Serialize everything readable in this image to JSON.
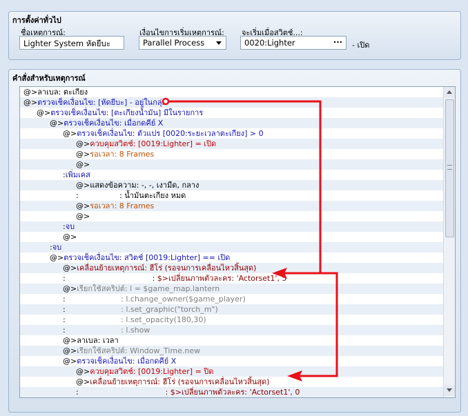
{
  "general": {
    "title": "การตั้งค่าทั่วไป",
    "event_name_label": "ชื่อเหตุการณ์:",
    "event_name_value": "Lighter System หัดยีบะ",
    "trigger_label": "เงื่อนไขการเริ่มเหตุการณ์:",
    "trigger_value": "Parallel Process",
    "switch_label": "จะเริ่มเมื่อสวิตช์...:",
    "switch_value": "0020:Lighter",
    "switch_suffix": "- เปิด"
  },
  "commands": {
    "title": "คำสั่งสำหรับเหตุการณ์",
    "rows": [
      {
        "indent": 0,
        "color": "#000000",
        "marker": "@>",
        "text": "ลาเบล: ตะเกียง"
      },
      {
        "indent": 0,
        "color": "#1515b0",
        "marker": "@>",
        "text": "ตรวจเช็คเงื่อนไข: [หัดยีบะ] - อยู่ในกลุ่ม"
      },
      {
        "indent": 1,
        "color": "#1515b0",
        "marker": "@>",
        "text": "ตรวจเช็คเงื่อนไข: [ตะเกียงน้ำมัน] มีในรายการ"
      },
      {
        "indent": 2,
        "color": "#1515b0",
        "marker": "@>",
        "text": "ตรวจเช็คเงื่อนไข: เมื่อกดคีย์ X"
      },
      {
        "indent": 3,
        "color": "#1515b0",
        "marker": "@>",
        "text": "ตรวจเช็คเงื่อนไข: ตัวแปร [0020:ระยะเวลาตะเกียง] > 0"
      },
      {
        "indent": 4,
        "color": "#c00000",
        "marker": "@>",
        "text": "ควบคุมสวิตช์: [0019:Lighter] = เปิด"
      },
      {
        "indent": 4,
        "color": "#c05000",
        "marker": "@>",
        "text": "รอเวลา: 8 Frames"
      },
      {
        "indent": 4,
        "color": "#000000",
        "marker": "@>",
        "text": ""
      },
      {
        "indent": 3,
        "color": "#1515b0",
        "marker": ":",
        "text": "เพิ่มเคส"
      },
      {
        "indent": 4,
        "color": "#000000",
        "marker": "@>",
        "text": "แสดงข้อความ: -, -, เงามืด, กลาง"
      },
      {
        "indent": 4,
        "color": "#000000",
        "marker": ":",
        "text": "                 : น้ำมันตะเกียง หมด"
      },
      {
        "indent": 4,
        "color": "#c05000",
        "marker": "@>",
        "text": "รอเวลา: 8 Frames"
      },
      {
        "indent": 4,
        "color": "#000000",
        "marker": "@>",
        "text": ""
      },
      {
        "indent": 3,
        "color": "#1515b0",
        "marker": ":",
        "text": "จบ"
      },
      {
        "indent": 3,
        "color": "#000000",
        "marker": "@>",
        "text": ""
      },
      {
        "indent": 2,
        "color": "#1515b0",
        "marker": ":",
        "text": "จบ"
      },
      {
        "indent": 2,
        "color": "#1515b0",
        "marker": "@>",
        "text": "ตรวจเช็คเงื่อนไข: สวิตช์ [0019:Lighter] == เปิด"
      },
      {
        "indent": 3,
        "color": "#8a0000",
        "marker": "@>",
        "text": "เคลื่อนย้ายเหตุการณ์: ฮีโร่ (รอจนการเคลื่อนไหวสิ้นสุด)"
      },
      {
        "indent": 3,
        "color": "#8a0000",
        "marker": ":",
        "text": "                                    : $>เปลี่ยนภาพตัวละคร: 'Actorset1', 5"
      },
      {
        "indent": 3,
        "color": "#808080",
        "marker": "@>",
        "text": "เรียกใช้สคริปต์: l = $game_map.lantern"
      },
      {
        "indent": 3,
        "color": "#808080",
        "marker": ":",
        "text": "                       : l.change_owner($game_player)"
      },
      {
        "indent": 3,
        "color": "#808080",
        "marker": ":",
        "text": "                       : l.set_graphic(\"torch_m\")"
      },
      {
        "indent": 3,
        "color": "#808080",
        "marker": ":",
        "text": "                       : l.set_opacity(180,30)"
      },
      {
        "indent": 3,
        "color": "#808080",
        "marker": ":",
        "text": "                       : l.show"
      },
      {
        "indent": 3,
        "color": "#000000",
        "marker": "@>",
        "text": "ลาเบล: เวลา"
      },
      {
        "indent": 3,
        "color": "#808080",
        "marker": "@>",
        "text": "เรียกใช้สคริปต์: Window_Time.new"
      },
      {
        "indent": 3,
        "color": "#1515b0",
        "marker": "@>",
        "text": "ตรวจเช็คเงื่อนไข: เมื่อกดคีย์ X"
      },
      {
        "indent": 4,
        "color": "#c00000",
        "marker": "@>",
        "text": "ควบคุมสวิตช์: [0019:Lighter] = ปิด"
      },
      {
        "indent": 4,
        "color": "#8a0000",
        "marker": "@>",
        "text": "เคลื่อนย้ายเหตุการณ์: ฮีโร่ (รอจนการเคลื่อนไหวสิ้นสุด)"
      },
      {
        "indent": 4,
        "color": "#8a0000",
        "marker": ":",
        "text": "                                    : $>เปลี่ยนภาพตัวละคร: 'Actorset1', 0"
      }
    ]
  },
  "annotation": {
    "color": "#e8101a"
  },
  "icons": [
    "dropdown-arrow-icon",
    "ellipsis-icon",
    "scroll-up-icon",
    "scroll-down-icon",
    "grip-icon"
  ]
}
